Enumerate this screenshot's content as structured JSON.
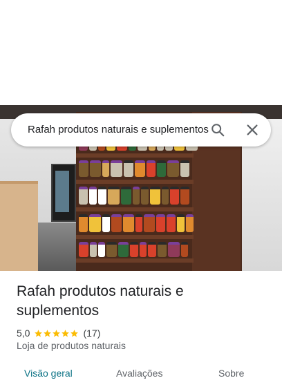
{
  "search": {
    "query": "Rafah produtos naturais e suplementos"
  },
  "place": {
    "name": "Rafah produtos naturais e suplementos",
    "rating": "5,0",
    "stars": 5,
    "review_count": "(17)",
    "category": "Loja de produtos naturais"
  },
  "tabs": [
    {
      "label": "Visão geral"
    },
    {
      "label": "Avaliações"
    },
    {
      "label": "Sobre"
    }
  ],
  "colors": {
    "accent": "#0b7285",
    "star": "#fbbc04"
  },
  "icons": {
    "search": "search-icon",
    "close": "close-icon",
    "star": "star-icon"
  }
}
